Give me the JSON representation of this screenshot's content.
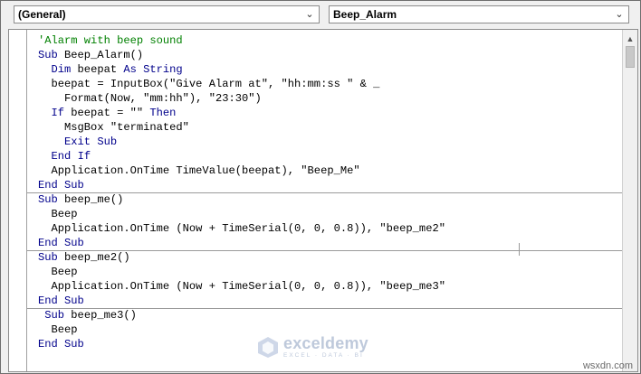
{
  "object_dropdown": {
    "value": "(General)",
    "icon": "chevron-down-icon"
  },
  "procedure_dropdown": {
    "value": "Beep_Alarm",
    "icon": "chevron-down-icon"
  },
  "code": {
    "lines": [
      [
        {
          "t": "'Alarm with beep sound",
          "c": "cm"
        }
      ],
      [
        {
          "t": "Sub",
          "c": "kw"
        },
        {
          "t": " Beep_Alarm()"
        }
      ],
      [
        {
          "t": "  "
        },
        {
          "t": "Dim",
          "c": "kw"
        },
        {
          "t": " beepat "
        },
        {
          "t": "As",
          "c": "kw"
        },
        {
          "t": " "
        },
        {
          "t": "String",
          "c": "kw"
        }
      ],
      [
        {
          "t": "  beepat = InputBox(\"Give Alarm at\", \"hh:mm:ss \" & _"
        }
      ],
      [
        {
          "t": "    Format(Now, \"mm:hh\"), \"23:30\")"
        }
      ],
      [
        {
          "t": "  "
        },
        {
          "t": "If",
          "c": "kw"
        },
        {
          "t": " beepat = \"\" "
        },
        {
          "t": "Then",
          "c": "kw"
        }
      ],
      [
        {
          "t": "    MsgBox \"terminated\""
        }
      ],
      [
        {
          "t": "    "
        },
        {
          "t": "Exit",
          "c": "kw"
        },
        {
          "t": " "
        },
        {
          "t": "Sub",
          "c": "kw"
        }
      ],
      [
        {
          "t": "  "
        },
        {
          "t": "End",
          "c": "kw"
        },
        {
          "t": " "
        },
        {
          "t": "If",
          "c": "kw"
        }
      ],
      [
        {
          "t": "  Application.OnTime TimeValue(beepat), \"Beep_Me\""
        }
      ],
      [
        {
          "t": "End",
          "c": "kw"
        },
        {
          "t": " "
        },
        {
          "t": "Sub",
          "c": "kw"
        }
      ],
      [
        {
          "t": "Sub",
          "c": "kw"
        },
        {
          "t": " beep_me()"
        }
      ],
      [
        {
          "t": "  Beep"
        }
      ],
      [
        {
          "t": "  Application.OnTime (Now + TimeSerial(0, 0, 0.8)), \"beep_me2\""
        }
      ],
      [
        {
          "t": "End",
          "c": "kw"
        },
        {
          "t": " "
        },
        {
          "t": "Sub",
          "c": "kw"
        }
      ],
      [
        {
          "t": "Sub",
          "c": "kw"
        },
        {
          "t": " beep_me2()"
        }
      ],
      [
        {
          "t": "  Beep"
        }
      ],
      [
        {
          "t": "  Application.OnTime (Now + TimeSerial(0, 0, 0.8)), \"beep_me3\""
        }
      ],
      [
        {
          "t": "End",
          "c": "kw"
        },
        {
          "t": " "
        },
        {
          "t": "Sub",
          "c": "kw"
        }
      ],
      [
        {
          "t": " "
        },
        {
          "t": "Sub",
          "c": "kw"
        },
        {
          "t": " beep_me3()"
        }
      ],
      [
        {
          "t": "  Beep"
        }
      ],
      [
        {
          "t": "End",
          "c": "kw"
        },
        {
          "t": " "
        },
        {
          "t": "Sub",
          "c": "kw"
        }
      ]
    ],
    "separators_after_line": [
      10,
      14,
      18
    ]
  },
  "logo": {
    "name": "exceldemy",
    "tagline": "EXCEL · DATA · BI"
  },
  "watermark": "wsxdn.com",
  "colors": {
    "keyword": "#00008b",
    "comment": "#008000",
    "text": "#000000"
  }
}
